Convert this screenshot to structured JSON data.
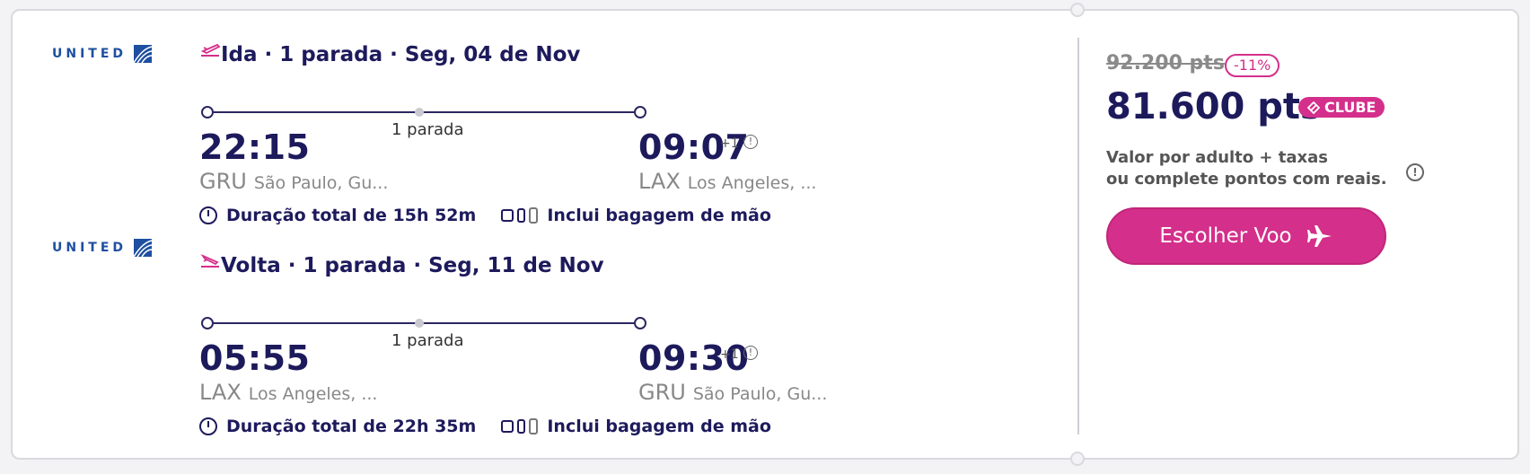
{
  "airline": {
    "name": "UNITED"
  },
  "legs": [
    {
      "title": "Ida · 1 parada · Seg, 04 de Nov",
      "depart_time": "22:15",
      "depart_code": "GRU",
      "depart_city": "São Paulo, Gu...",
      "arrive_time": "09:07",
      "arrive_plus": "+1",
      "arrive_code": "LAX",
      "arrive_city": "Los Angeles, ...",
      "stops": "1 parada",
      "duration": "Duração total de 15h 52m",
      "baggage": "Inclui bagagem de mão"
    },
    {
      "title": "Volta · 1 parada · Seg, 11 de Nov",
      "depart_time": "05:55",
      "depart_code": "LAX",
      "depart_city": "Los Angeles, ...",
      "arrive_time": "09:30",
      "arrive_plus": "+1",
      "arrive_code": "GRU",
      "arrive_city": "São Paulo, Gu...",
      "stops": "1 parada",
      "duration": "Duração total de 22h 35m",
      "baggage": "Inclui bagagem de mão"
    }
  ],
  "pricing": {
    "old_price": "92.200 pts",
    "discount": "-11%",
    "new_price": "81.600 pts",
    "club_label": "CLUBE",
    "note_line1": "Valor por adulto + taxas",
    "note_line2": "ou complete pontos com reais.",
    "button_label": "Escolher Voo"
  },
  "colors": {
    "brand_pink": "#d42f8b",
    "navy": "#1d1a5c",
    "united_blue": "#1e4fa0"
  },
  "icons": [
    "departure-icon",
    "return-icon",
    "clock-icon",
    "baggage-icon",
    "info-icon",
    "plane-icon",
    "club-icon"
  ]
}
